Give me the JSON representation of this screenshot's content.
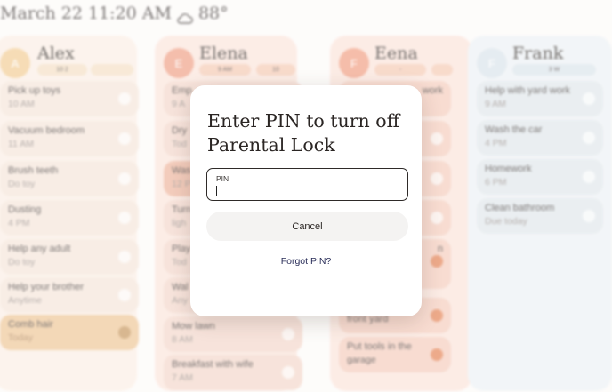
{
  "header": {
    "date": "March 22",
    "time": "11:20 AM",
    "weather_icon": "cloud-icon",
    "temperature": "88°"
  },
  "columns": [
    {
      "name": "Alex",
      "initial": "A",
      "avatar_color": "#f3cf9a",
      "pills": [
        "10 2",
        ""
      ],
      "tasks": [
        {
          "title": "Pick up toys",
          "sub": "10 AM",
          "done": true
        },
        {
          "title": "Vacuum bedroom",
          "sub": "11 AM",
          "done": false
        },
        {
          "title": "Brush teeth",
          "sub": "Do toy",
          "done": false
        },
        {
          "title": "Dusting",
          "sub": "4 PM",
          "done": false
        },
        {
          "title": "Help any adult",
          "sub": "Do toy",
          "done": false
        },
        {
          "title": "Help your brother",
          "sub": "Anytime",
          "done": false
        },
        {
          "title": "Comb hair",
          "sub": "Today",
          "done": true,
          "highlight": true
        }
      ]
    },
    {
      "name": "Elena",
      "initial": "E",
      "avatar_color": "#f0a58c",
      "pills": [
        "9 AM",
        "10"
      ],
      "tasks": [
        {
          "title": "Emp",
          "sub": "9 A",
          "done": false
        },
        {
          "title": "Dry",
          "sub": "Tod",
          "done": false
        },
        {
          "title": "Was",
          "sub": "12 P",
          "done": false
        },
        {
          "title": "Turn",
          "sub": "ligh",
          "done": false
        },
        {
          "title": "Play",
          "sub": "Tod",
          "done": false
        },
        {
          "title": "Wal",
          "sub": "Any",
          "done": false
        },
        {
          "title": "Mow lawn",
          "sub": "8 AM",
          "done": false
        },
        {
          "title": "Breakfast with wife",
          "sub": "7 AM",
          "done": false
        }
      ]
    },
    {
      "name": "Eena",
      "initial": "F",
      "avatar_color": "#f2a489",
      "pills": [
        "-",
        ""
      ],
      "tasks": [
        {
          "title": "work",
          "sub": "",
          "done": false
        },
        {
          "title": "",
          "sub": "",
          "done": false
        },
        {
          "title": "",
          "sub": "",
          "done": false
        },
        {
          "title": "",
          "sub": "",
          "done": false
        },
        {
          "title": "n",
          "sub": "",
          "done": false
        },
        {
          "title": "front yard",
          "sub": "",
          "done": false
        },
        {
          "title": "Put tools in the",
          "sub": "garage",
          "done": false
        }
      ]
    },
    {
      "name": "Frank",
      "initial": "F",
      "avatar_color": "#dce5ec",
      "pills": [
        "3 W"
      ],
      "tasks": [
        {
          "title": "Help with yard work",
          "sub": "9 AM",
          "done": false
        },
        {
          "title": "Wash the car",
          "sub": "4 PM",
          "done": false
        },
        {
          "title": "Homework",
          "sub": "6 PM",
          "done": false
        },
        {
          "title": "Clean bathroom",
          "sub": "Due today",
          "done": false
        }
      ]
    }
  ],
  "dialog": {
    "title": "Enter PIN to turn off Parental Lock",
    "pin_label": "PIN",
    "pin_value": "",
    "cancel_label": "Cancel",
    "forgot_label": "Forgot PIN?"
  }
}
